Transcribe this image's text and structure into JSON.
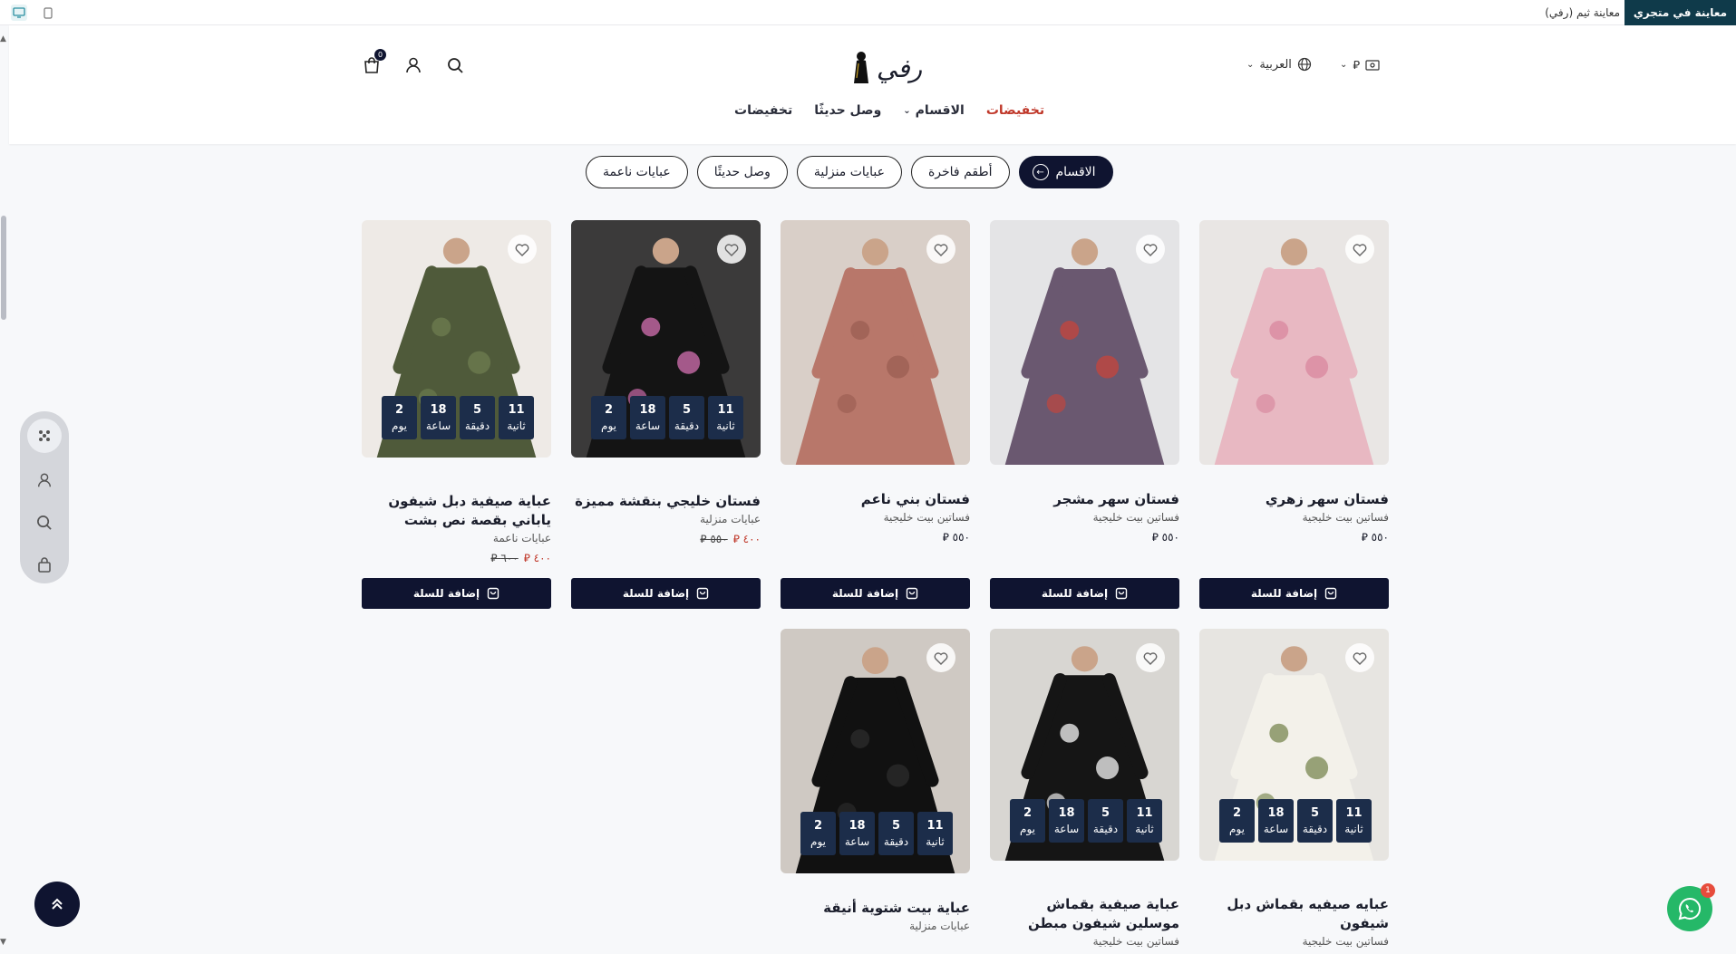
{
  "preview_bar": {
    "button_label": "معاينة في متجري",
    "theme_text": "معاينة ثيم (رفي)",
    "devices": [
      "desktop-icon",
      "mobile-icon"
    ]
  },
  "header": {
    "logo_text": "رفي",
    "language": "العربية",
    "currency_symbol": "⃁",
    "cart_count": "0",
    "nav": [
      {
        "label": "تخفيضات",
        "type": "sale"
      },
      {
        "label": "الاقسام",
        "type": "dropdown"
      },
      {
        "label": "وصل حديثًا",
        "type": "normal"
      },
      {
        "label": "تخفيضات",
        "type": "normal"
      }
    ]
  },
  "chips": [
    "الاقسام",
    "أطقم فاخرة",
    "عبايات منزلية",
    "وصل حديثًا",
    "عبايات ناعمة"
  ],
  "add_to_cart_label": "إضافة للسلة",
  "countdown_labels": {
    "seconds": "ثانية",
    "minutes": "دقيقة",
    "hours": "ساعة",
    "days": "يوم"
  },
  "products": [
    {
      "title": "فستان سهر زهري",
      "category": "فساتين بيت خليجية",
      "price": "٥٥٠",
      "old_price": "",
      "countdown": null,
      "image": "pink-gown"
    },
    {
      "title": "فستان سهر مشجر",
      "category": "فساتين بيت خليجية",
      "price": "٥٥٠",
      "old_price": "",
      "countdown": null,
      "image": "floral-gown"
    },
    {
      "title": "فستان بني ناعم",
      "category": "فساتين بيت خليجية",
      "price": "٥٥٠",
      "old_price": "",
      "countdown": null,
      "image": "brown-dress"
    },
    {
      "title": "فستان خليجي بنقشة مميزة",
      "category": "عبايات منزلية",
      "price": "٤٠٠",
      "old_price": "٥٥٠",
      "countdown": {
        "seconds": "11",
        "minutes": "5",
        "hours": "18",
        "days": "2"
      },
      "image": "black-floral-abaya"
    },
    {
      "title": "عباية صيفية دبل شيفون ياباني بقصة نص بشت",
      "category": "عبايات ناعمة",
      "price": "٤٠٠",
      "old_price": "٦٠٠",
      "countdown": {
        "seconds": "11",
        "minutes": "5",
        "hours": "18",
        "days": "2"
      },
      "image": "green-abaya"
    },
    {
      "title": "عبايه صيفيه بقماش دبل شيفون",
      "category": "فساتين بيت خليجية",
      "price": "",
      "old_price": "",
      "countdown": {
        "seconds": "11",
        "minutes": "5",
        "hours": "18",
        "days": "2"
      },
      "image": "white-abaya"
    },
    {
      "title": "عباية صيفية بقماش موسلين شيفون مبطن",
      "category": "فساتين بيت خليجية",
      "price": "",
      "old_price": "",
      "countdown": {
        "seconds": "11",
        "minutes": "5",
        "hours": "18",
        "days": "2"
      },
      "image": "bw-floral-abaya"
    },
    {
      "title": "عباية بيت شتوية أنيقة",
      "category": "عبايات منزلية",
      "price": "",
      "old_price": "",
      "countdown": {
        "seconds": "11",
        "minutes": "5",
        "hours": "18",
        "days": "2"
      },
      "image": "black-abaya"
    }
  ],
  "whatsapp_badge": "1",
  "colors": {
    "primary": "#0f1430",
    "sale": "#c0392b",
    "countdown": "#1c2d4a",
    "whatsapp": "#25b868"
  }
}
